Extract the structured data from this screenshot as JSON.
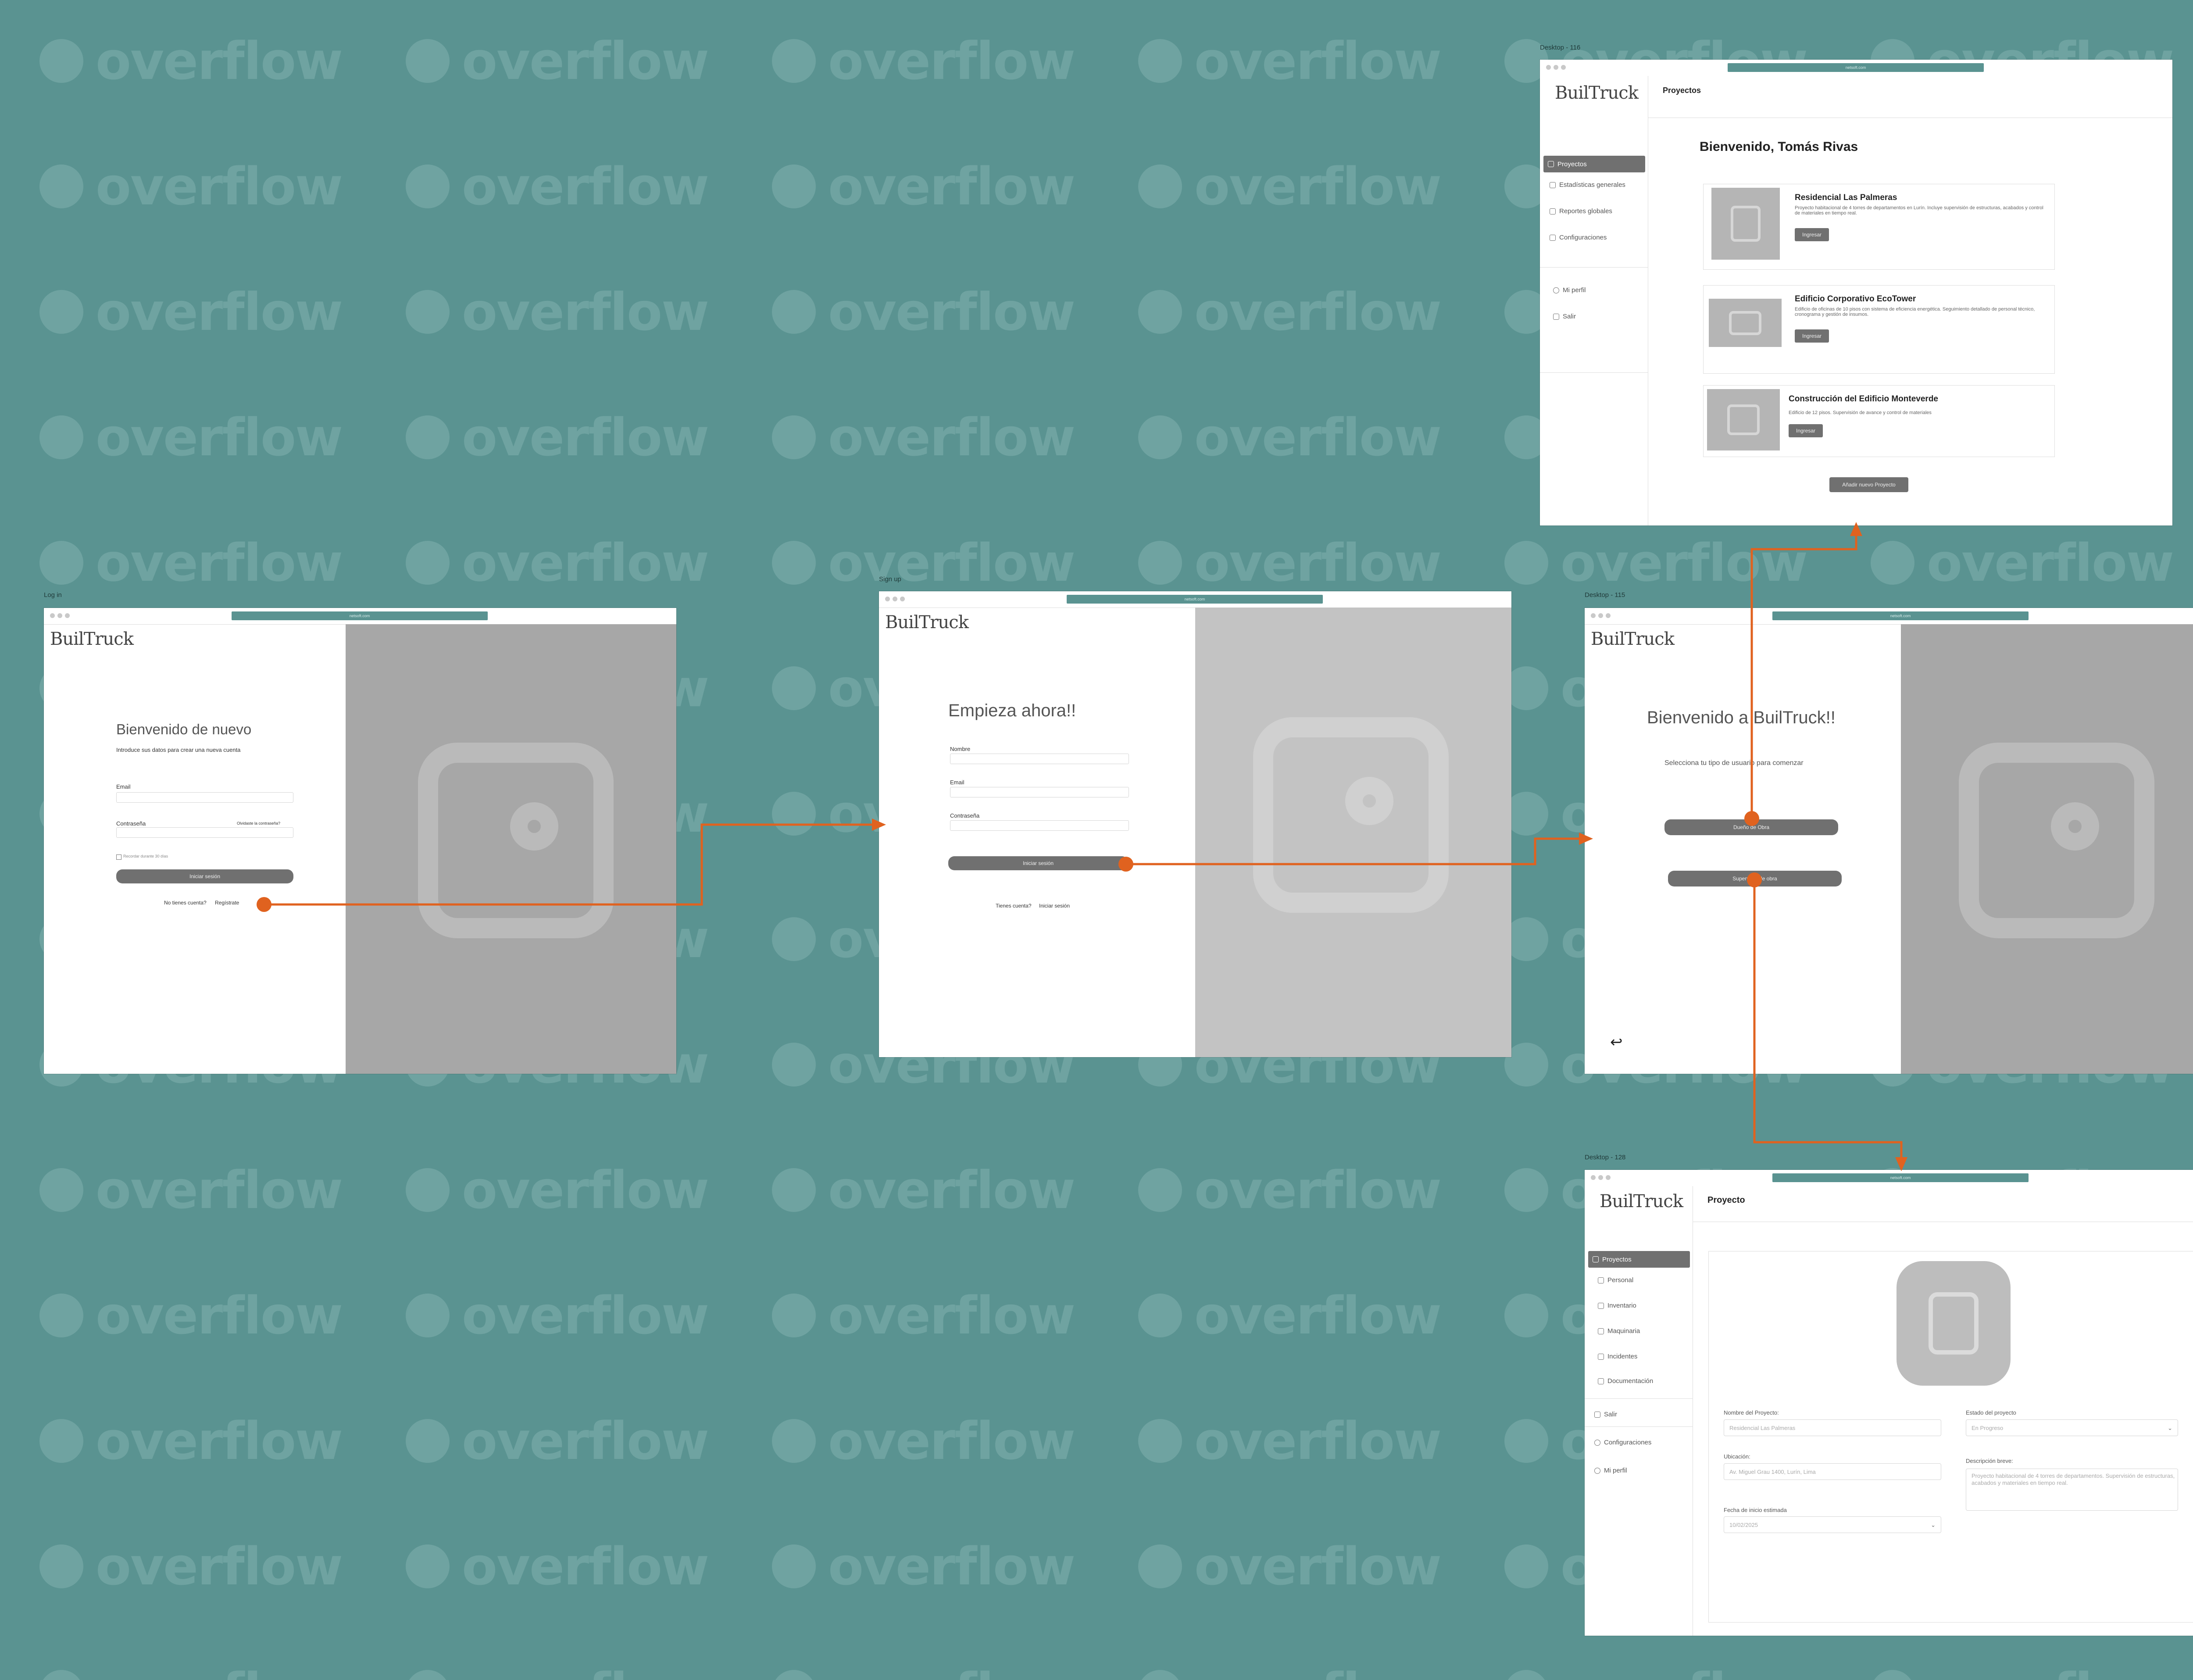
{
  "watermark": "overflow",
  "colors": {
    "canvas": "#5a9391",
    "accent_link": "#e0621f",
    "button_grey": "#707070"
  },
  "url_text": "netsoft.com",
  "logo": "BuilTruck",
  "login": {
    "frame_label": "Log in",
    "welcome": "Bienvenido de nuevo",
    "subtitle": "Introduce sus datos para crear una nueva cuenta",
    "email_label": "Email",
    "password_label": "Contraseña",
    "forgot": "Olvidaste la contraseña?",
    "remember": "Recordar durante 30 días",
    "submit": "Iniciar sesión",
    "no_account": "No tienes cuenta?",
    "register": "Regístrate"
  },
  "signup": {
    "frame_label": "Sign up",
    "title": "Empieza ahora!!",
    "name_label": "Nombre",
    "email_label": "Email",
    "password_label": "Contraseña",
    "submit": "Iniciar sesión",
    "have_account": "Tienes cuenta?",
    "login_link": "Iniciar sesión"
  },
  "role": {
    "frame_label": "Desktop - 115",
    "title": "Bienvenido a BuilTruck!!",
    "subtitle": "Selecciona tu tipo de usuario para comenzar",
    "option_owner": "Dueño de Obra",
    "option_supervisor": "Supervisor de obra",
    "back_icon": "↩"
  },
  "projects": {
    "frame_label": "Desktop - 116",
    "header": "Proyectos",
    "greeting": "Bienvenido, Tomás Rivas",
    "sidebar": [
      "Proyectos",
      "Estadísticas generales",
      "Reportes globales",
      "Configuraciones"
    ],
    "sidebar_bottom": [
      "Mi perfil",
      "Salir"
    ],
    "cards": [
      {
        "title": "Residencial Las Palmeras",
        "desc": "Proyecto habitacional de 4 torres de departamentos en Lurín. Incluye supervisión de estructuras, acabados y control de materiales en tiempo real.",
        "button": "Ingresar"
      },
      {
        "title": "Edificio Corporativo EcoTower",
        "desc": "Edificio de oficinas de 10 pisos con sistema de eficiencia energética. Seguimiento detallado de personal técnico, cronograma y gestión de insumos.",
        "button": "Ingresar"
      },
      {
        "title": "Construcción del Edificio Monteverde",
        "desc": "Edificio de 12 pisos. Supervisión de avance y control de materiales",
        "button": "Ingresar"
      }
    ],
    "add_button": "Añadir nuevo Proyecto"
  },
  "project_detail": {
    "frame_label": "Desktop - 128",
    "header": "Proyecto",
    "sidebar": [
      "Proyectos",
      "Personal",
      "Inventario",
      "Maquinaria",
      "Incidentes",
      "Documentación"
    ],
    "sidebar_bottom": [
      "Salir",
      "Configuraciones",
      "Mi perfil"
    ],
    "name_label": "Nombre del Proyecto:",
    "name_value": "Residencial Las Palmeras",
    "status_label": "Estado del proyecto",
    "status_value": "En Progreso",
    "location_label": "Ubicación:",
    "location_value": "Av. Miguel Grau 1400, Lurín, Lima",
    "description_label": "Descripción breve:",
    "description_value": "Proyecto habitacional de 4 torres de departamentos. Supervisión de estructuras, acabados y materiales en tiempo real.",
    "start_label": "Fecha de inicio estimada",
    "start_value": "10/02/2025"
  }
}
